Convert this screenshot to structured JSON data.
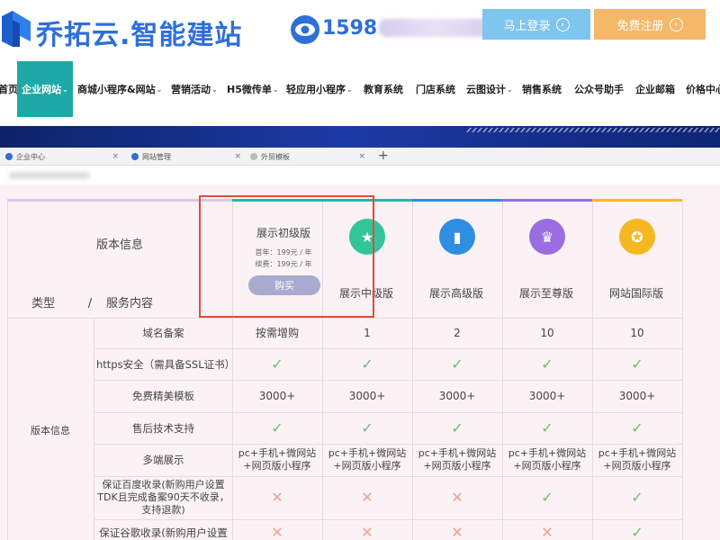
{
  "header": {
    "brand": "乔拓云.智能建站",
    "phone_visible": "1598",
    "login_label": "马上登录",
    "register_label": "免费注册",
    "colors": {
      "brand": "#2f6fd8",
      "login": "#7ec5f0",
      "register": "#f5b868",
      "active_nav": "#1fa9a6"
    }
  },
  "nav": [
    {
      "label": "首页",
      "caret": false
    },
    {
      "label": "企业网站",
      "caret": true,
      "active": true
    },
    {
      "label": "商城小程序&网站",
      "caret": true
    },
    {
      "label": "营销活动",
      "caret": true
    },
    {
      "label": "H5微传单",
      "caret": true
    },
    {
      "label": "轻应用小程序",
      "caret": true
    },
    {
      "label": "教育系统",
      "caret": false
    },
    {
      "label": "门店系统",
      "caret": false
    },
    {
      "label": "云图设计",
      "caret": true
    },
    {
      "label": "销售系统",
      "caret": false
    },
    {
      "label": "公众号助手",
      "caret": false
    },
    {
      "label": "企业邮箱",
      "caret": false
    },
    {
      "label": "价格中心",
      "caret": false
    }
  ],
  "tabs": [
    {
      "label": "企业中心"
    },
    {
      "label": "网站管理"
    },
    {
      "label": "外贸模板"
    }
  ],
  "table": {
    "version_info": "版本信息",
    "type_label": "类型",
    "slash": "/",
    "service_label": "服务内容",
    "group_label": "版本信息",
    "basic": {
      "name": "展示初级版",
      "price_year": "首年：199元 / 年",
      "price_renew": "续费：199元 / 年",
      "buy": "购买"
    },
    "plans": [
      {
        "name": "展示中级版",
        "icon": "star-icon",
        "color": "#33c49a"
      },
      {
        "name": "展示高级版",
        "icon": "bookmark-icon",
        "color": "#2f8ee0"
      },
      {
        "name": "展示至尊版",
        "icon": "crown-icon",
        "color": "#9a6ee0"
      },
      {
        "name": "网站国际版",
        "icon": "medal-icon",
        "color": "#f6b820"
      }
    ],
    "colbar_colors": [
      "#27b8a8",
      "#27b8a8",
      "#2f8ee0",
      "#9a6ee0",
      "#f6b820"
    ],
    "rows": [
      {
        "label": "域名备案",
        "values": [
          "按需增购",
          "1",
          "2",
          "10",
          "10"
        ]
      },
      {
        "label": "https安全（需具备SSL证书）",
        "values": [
          "✓",
          "✓",
          "✓",
          "✓",
          "✓"
        ]
      },
      {
        "label": "免费精美模板",
        "values": [
          "3000+",
          "3000+",
          "3000+",
          "3000+",
          "3000+"
        ]
      },
      {
        "label": "售后技术支持",
        "values": [
          "✓",
          "✓",
          "✓",
          "✓",
          "✓"
        ]
      },
      {
        "label": "多端展示",
        "values": [
          "pc+手机+微网站\n+网页版小程序",
          "pc+手机+微网站\n+网页版小程序",
          "pc+手机+微网站\n+网页版小程序",
          "pc+手机+微网站\n+网页版小程序",
          "pc+手机+微网站\n+网页版小程序"
        ]
      },
      {
        "label": "保证百度收录(新购用户设置TDK且完成备案90天不收录，支持退款)",
        "values": [
          "✗",
          "✗",
          "✗",
          "✓",
          "✓"
        ]
      },
      {
        "label": "保证谷歌收录(新购用户设置",
        "values": [
          "✗",
          "✗",
          "✗",
          "✗",
          "✓"
        ]
      }
    ]
  }
}
